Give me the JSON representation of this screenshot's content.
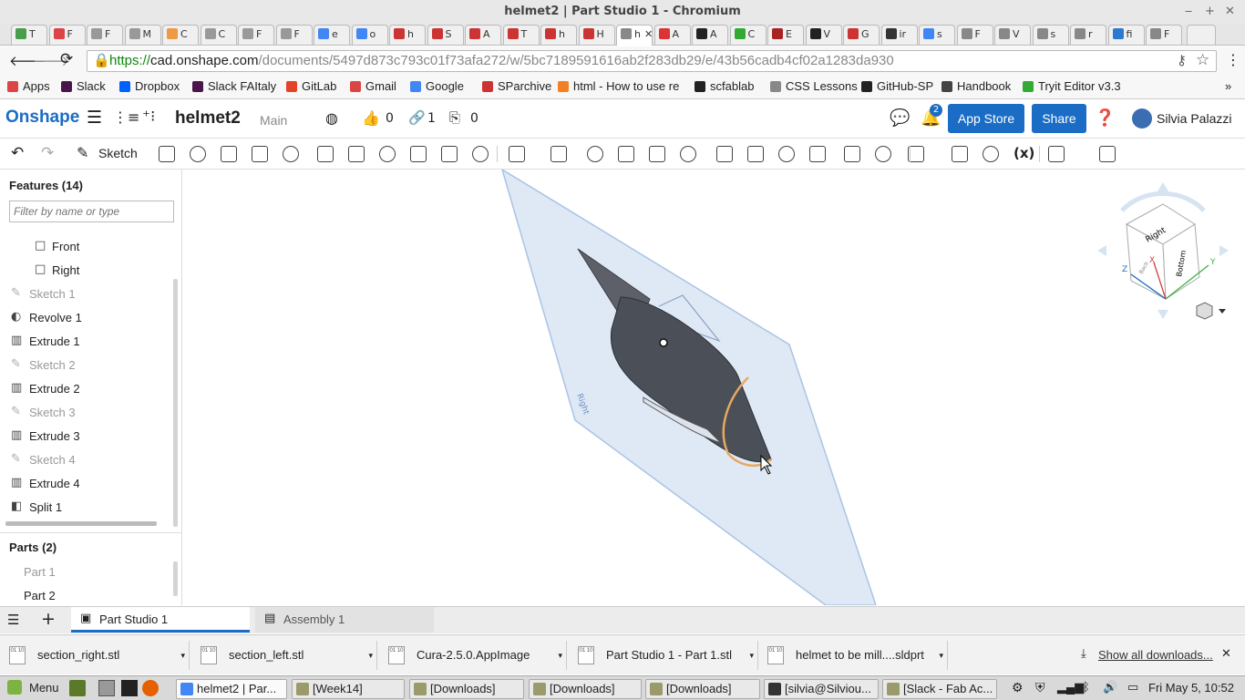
{
  "window": {
    "title": "helmet2 | Part Studio 1 - Chromium"
  },
  "browser_tabs": [
    "T",
    "F",
    "F",
    "M",
    "C",
    "C",
    "F",
    "F",
    "e",
    "o",
    "h",
    "S",
    "A",
    "T",
    "h",
    "H",
    "h",
    "A",
    "A",
    "C",
    "E",
    "V",
    "G",
    "ir",
    "s",
    "F",
    "V",
    "s",
    "r",
    "fi",
    "F"
  ],
  "address": {
    "scheme": "https://",
    "host": "cad.onshape.com",
    "path": "/documents/5497d873c793c01f73afa272/w/5bc7189591616ab2f283db29/e/43b56cadb4cf02a1283da930"
  },
  "bookmarks": [
    "Apps",
    "Slack",
    "Dropbox",
    "Slack FAItaly",
    "GitLab",
    "Gmail",
    "Google",
    "SParchive",
    "html - How to use re",
    "scfablab",
    "CSS Lessons",
    "GitHub-SP",
    "Handbook",
    "Tryit Editor v3.3"
  ],
  "onshape": {
    "logo": "Onshape",
    "doc_name": "helmet2",
    "branch": "Main",
    "likes": "0",
    "links": "1",
    "copies": "0",
    "notifications": "2",
    "app_store": "App Store",
    "share": "Share",
    "user": "Silvia Palazzi"
  },
  "toolbar": {
    "sketch": "Sketch",
    "fx": "(x)"
  },
  "features": {
    "header": "Features (14)",
    "filter_placeholder": "Filter by name or type",
    "items": [
      {
        "label": "Front",
        "icon": "plane-icon",
        "dim": false
      },
      {
        "label": "Right",
        "icon": "plane-icon",
        "dim": false
      },
      {
        "label": "Sketch 1",
        "icon": "sketch-icon",
        "dim": true
      },
      {
        "label": "Revolve 1",
        "icon": "revolve-icon",
        "dim": false
      },
      {
        "label": "Extrude 1",
        "icon": "extrude-icon",
        "dim": false
      },
      {
        "label": "Sketch 2",
        "icon": "sketch-icon",
        "dim": true
      },
      {
        "label": "Extrude 2",
        "icon": "extrude-icon",
        "dim": false
      },
      {
        "label": "Sketch 3",
        "icon": "sketch-icon",
        "dim": true
      },
      {
        "label": "Extrude 3",
        "icon": "extrude-icon",
        "dim": false
      },
      {
        "label": "Sketch 4",
        "icon": "sketch-icon",
        "dim": true
      },
      {
        "label": "Extrude 4",
        "icon": "extrude-icon",
        "dim": false
      },
      {
        "label": "Split 1",
        "icon": "split-icon",
        "dim": false
      }
    ]
  },
  "parts": {
    "header": "Parts (2)",
    "items": [
      {
        "label": "Part 1",
        "dim": true
      },
      {
        "label": "Part 2",
        "dim": false
      }
    ]
  },
  "viewcube": {
    "face_top": "Right",
    "face_front": "Bottom",
    "face_side": "Back",
    "x": "X",
    "y": "Y",
    "z": "Z",
    "plane_label": "Right"
  },
  "bottom_tabs": [
    "Part Studio 1",
    "Assembly 1"
  ],
  "downloads": {
    "items": [
      "section_right.stl",
      "section_left.stl",
      "Cura-2.5.0.AppImage",
      "Part Studio 1 - Part 1.stl",
      "helmet to be mill....sldprt"
    ],
    "show_all": "Show all downloads..."
  },
  "taskbar": {
    "menu": "Menu",
    "windows": [
      "helmet2 | Par...",
      "[Week14]",
      "[Downloads]",
      "[Downloads]",
      "[Downloads]",
      "[silvia@Silviou...",
      "[Slack - Fab Ac..."
    ],
    "clock": "Fri May  5, 10:52"
  },
  "colors": {
    "brand": "#1a6cc4",
    "accent_edge": "#e8a860",
    "plane": "#dfe9f6"
  }
}
